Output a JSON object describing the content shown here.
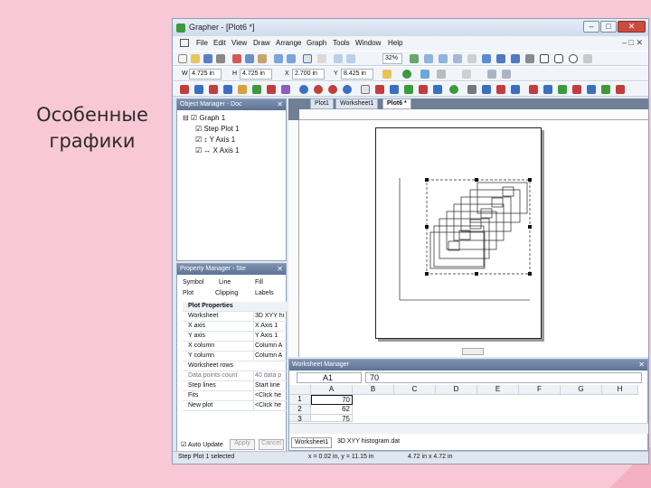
{
  "slide": {
    "title_line1": "Особенные",
    "title_line2": "графики"
  },
  "app": {
    "title": "Grapher - [Plot6 *]"
  },
  "menu": [
    "File",
    "Edit",
    "View",
    "Draw",
    "Arrange",
    "Graph",
    "Tools",
    "Window",
    "Help"
  ],
  "toolbar_fields": {
    "zoom": "32%",
    "w_label": "W",
    "w_value": "4.725 in",
    "h_label": "H",
    "h_value": "4.725 in",
    "x_label": "X",
    "x_value": "2.700 in",
    "y_label": "Y",
    "y_value": "8.425 in"
  },
  "object_manager": {
    "title": "Object Manager - Doc",
    "items": [
      "Graph 1",
      "Step Plot 1",
      "Y Axis 1",
      "X Axis 1"
    ]
  },
  "property_manager": {
    "title": "Property Manager - Ste",
    "tabs": [
      "Symbol",
      "Line",
      "Fill",
      "Plot",
      "Clipping",
      "Labels"
    ],
    "rows": [
      {
        "k": "Plot Properties",
        "v": ""
      },
      {
        "k": "Worksheet",
        "v": "3D XYY hi"
      },
      {
        "k": "X axis",
        "v": "X Axis 1"
      },
      {
        "k": "Y axis",
        "v": "Y Axis 1"
      },
      {
        "k": "X column",
        "v": "Column A"
      },
      {
        "k": "Y column",
        "v": "Column A"
      },
      {
        "k": "Worksheet rows",
        "v": ""
      },
      {
        "k": "Data points count",
        "v": "40 data p"
      },
      {
        "k": "Step lines",
        "v": "Start line"
      },
      {
        "k": "Fits",
        "v": "<Click he"
      },
      {
        "k": "New plot",
        "v": "<Click he"
      }
    ],
    "auto_update": "Auto Update",
    "apply": "Apply",
    "cancel": "Cancel"
  },
  "doc_tabs": [
    "Plot1",
    "Worksheet1",
    "Plot6 *"
  ],
  "worksheet_manager": {
    "title": "Worksheet Manager",
    "cell_ref": "A1",
    "cell_value": "70",
    "columns": [
      "A",
      "B",
      "C",
      "D",
      "E",
      "F",
      "G",
      "H"
    ],
    "rows": [
      {
        "n": "1",
        "a": "70"
      },
      {
        "n": "2",
        "a": "62"
      },
      {
        "n": "3",
        "a": "75"
      }
    ],
    "tabs": [
      "Worksheet1",
      "3D XYY histogram.dat"
    ]
  },
  "status": {
    "selection": "Step Plot 1 selected",
    "coords": "x = 0.02 in, y = 11.15 in",
    "size": "4.72 in x 4.72 in"
  },
  "colors": {
    "background": "#f8c8d6",
    "selection": "#3a74c6",
    "titlebar": "#cfdbeb"
  }
}
